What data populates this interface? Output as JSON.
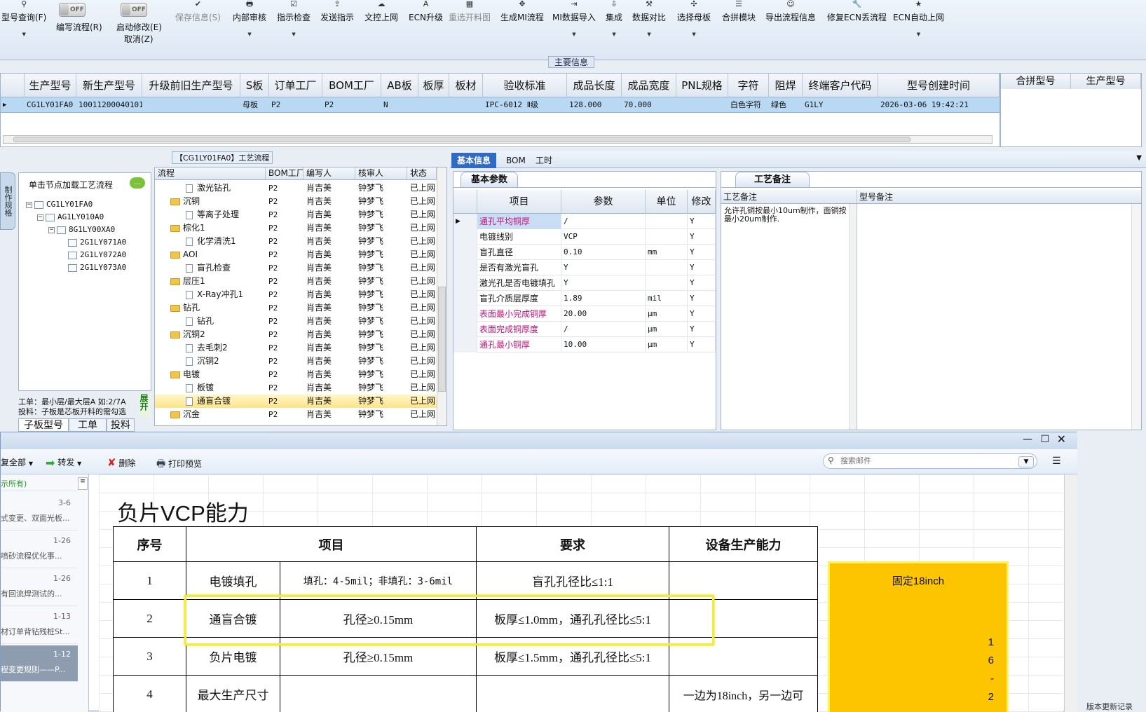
{
  "toolbar": {
    "items": [
      {
        "label": "型号查询(F)",
        "icon": "⚲"
      },
      {
        "label": "保存信息(S)",
        "icon": "✔"
      },
      {
        "label": "内部审核",
        "icon": "🖶"
      },
      {
        "label": "指示检查",
        "icon": "☑"
      },
      {
        "label": "发送指示",
        "icon": "⇪"
      },
      {
        "label": "文控上网",
        "icon": "☁"
      },
      {
        "label": "ECN升级",
        "icon": "A"
      },
      {
        "label": "重选开料图",
        "icon": "▦"
      },
      {
        "label": "生成MI流程",
        "icon": "✥"
      },
      {
        "label": "MI数据导入",
        "icon": "⇥"
      },
      {
        "label": "集成",
        "icon": "⇩"
      },
      {
        "label": "数据对比",
        "icon": "⚒"
      },
      {
        "label": "选择母板",
        "icon": "✣"
      },
      {
        "label": "合拼模块",
        "icon": "☰"
      },
      {
        "label": "导出流程信息",
        "icon": "☺"
      },
      {
        "label": "修复ECN丢流程",
        "icon": "🔧"
      },
      {
        "label": "ECN自动上网",
        "icon": "★"
      }
    ],
    "toggle_text": "OFF",
    "write_flow": "编写流程(R)",
    "start_edit": "启动修改(E)",
    "cancel": "取消(Z)"
  },
  "main_info": {
    "title": "主要信息",
    "columns": [
      "生产型号",
      "新生产型号",
      "升级前旧生产型号",
      "S板",
      "订单工厂",
      "BOM工厂",
      "AB板",
      "板厚",
      "板材",
      "验收标准",
      "成品长度",
      "成品宽度",
      "PNL规格",
      "字符",
      "阻焊",
      "终端客户代码",
      "型号创建时间"
    ],
    "row": [
      "CG1LY01FA0",
      "10011200040101",
      "",
      "母板",
      "P2",
      "P2",
      "N",
      "",
      "",
      "IPC-6012 Ⅱ级",
      "128.000",
      "70.000",
      "",
      "白色字符",
      "绿色",
      "G1LY",
      "2026-03-06 19:42:21"
    ],
    "right_columns": [
      "合拼型号",
      "生产型号"
    ]
  },
  "tree": {
    "vtab": "制作规格",
    "header": "单击节点加载工艺流程",
    "nodes": [
      "CG1LY01FA0",
      "AG1LY010A0",
      "8G1LY00XA0",
      "2G1LY071A0",
      "2G1LY072A0",
      "2G1LY073A0"
    ],
    "note1": "工单：最小层/最大层A 如:2/7A",
    "note2": "投料：子板是芯板开料的需勾选",
    "expand": "展开",
    "tabs": [
      "子板型号",
      "工单",
      "投料"
    ]
  },
  "process": {
    "title": "【CG1LY01FA0】工艺流程",
    "columns": [
      "流程",
      "BOM工厂",
      "编写人",
      "核审人",
      "状态"
    ],
    "rows": [
      {
        "name": "激光钻孔",
        "level": 2,
        "type": "doc",
        "bom": "P2",
        "writer": "肖吉美",
        "checker": "钟梦飞",
        "status": "已上网"
      },
      {
        "name": "沉铜",
        "level": 1,
        "type": "folder",
        "bom": "P2",
        "writer": "肖吉美",
        "checker": "钟梦飞",
        "status": "已上网"
      },
      {
        "name": "等离子处理",
        "level": 2,
        "type": "doc",
        "bom": "P2",
        "writer": "肖吉美",
        "checker": "钟梦飞",
        "status": "已上网"
      },
      {
        "name": "棕化1",
        "level": 1,
        "type": "folder",
        "bom": "P2",
        "writer": "肖吉美",
        "checker": "钟梦飞",
        "status": "已上网"
      },
      {
        "name": "化学清洗1",
        "level": 2,
        "type": "doc",
        "bom": "P2",
        "writer": "肖吉美",
        "checker": "钟梦飞",
        "status": "已上网"
      },
      {
        "name": "AOI",
        "level": 1,
        "type": "folder",
        "bom": "P2",
        "writer": "肖吉美",
        "checker": "钟梦飞",
        "status": "已上网"
      },
      {
        "name": "盲孔检查",
        "level": 2,
        "type": "doc",
        "bom": "P2",
        "writer": "肖吉美",
        "checker": "钟梦飞",
        "status": "已上网"
      },
      {
        "name": "层压1",
        "level": 1,
        "type": "folder",
        "bom": "P2",
        "writer": "肖吉美",
        "checker": "钟梦飞",
        "status": "已上网"
      },
      {
        "name": "X-Ray冲孔1",
        "level": 2,
        "type": "doc",
        "bom": "P2",
        "writer": "肖吉美",
        "checker": "钟梦飞",
        "status": "已上网"
      },
      {
        "name": "钻孔",
        "level": 1,
        "type": "folder",
        "bom": "P2",
        "writer": "肖吉美",
        "checker": "钟梦飞",
        "status": "已上网"
      },
      {
        "name": "钻孔",
        "level": 2,
        "type": "doc",
        "bom": "P2",
        "writer": "肖吉美",
        "checker": "钟梦飞",
        "status": "已上网"
      },
      {
        "name": "沉铜2",
        "level": 1,
        "type": "folder",
        "bom": "P2",
        "writer": "肖吉美",
        "checker": "钟梦飞",
        "status": "已上网"
      },
      {
        "name": "去毛刺2",
        "level": 2,
        "type": "doc",
        "bom": "P2",
        "writer": "肖吉美",
        "checker": "钟梦飞",
        "status": "已上网"
      },
      {
        "name": "沉铜2",
        "level": 2,
        "type": "doc",
        "bom": "P2",
        "writer": "肖吉美",
        "checker": "钟梦飞",
        "status": "已上网"
      },
      {
        "name": "电镀",
        "level": 1,
        "type": "folder",
        "bom": "P2",
        "writer": "肖吉美",
        "checker": "钟梦飞",
        "status": "已上网"
      },
      {
        "name": "板镀",
        "level": 2,
        "type": "doc",
        "bom": "P2",
        "writer": "肖吉美",
        "checker": "钟梦飞",
        "status": "已上网"
      },
      {
        "name": "通盲合镀",
        "level": 2,
        "type": "doc",
        "bom": "P2",
        "writer": "肖吉美",
        "checker": "钟梦飞",
        "status": "已上网",
        "selected": true
      },
      {
        "name": "沉金",
        "level": 1,
        "type": "folder",
        "bom": "P2",
        "writer": "肖吉美",
        "checker": "钟梦飞",
        "status": "已上网"
      }
    ]
  },
  "right_tabs": [
    "基本信息",
    "BOM",
    "工时"
  ],
  "params": {
    "tab": "基本参数",
    "columns": [
      "项目",
      "参数",
      "单位",
      "修改"
    ],
    "rows": [
      {
        "item": "通孔平均铜厚",
        "value": "/",
        "unit": "",
        "mod": "Y",
        "pink": true
      },
      {
        "item": "电镀线别",
        "value": "VCP",
        "unit": "",
        "mod": "Y",
        "pink": false
      },
      {
        "item": "盲孔直径",
        "value": "0.10",
        "unit": "mm",
        "mod": "Y",
        "pink": false
      },
      {
        "item": "是否有激光盲孔",
        "value": "Y",
        "unit": "",
        "mod": "Y",
        "pink": false
      },
      {
        "item": "激光孔是否电镀填孔",
        "value": "Y",
        "unit": "",
        "mod": "Y",
        "pink": false
      },
      {
        "item": "盲孔介质层厚度",
        "value": "1.89",
        "unit": "mil",
        "mod": "Y",
        "pink": false
      },
      {
        "item": "表面最小完成铜厚",
        "value": "20.00",
        "unit": "μm",
        "mod": "Y",
        "pink": true
      },
      {
        "item": "表面完成铜厚度",
        "value": "/",
        "unit": "μm",
        "mod": "Y",
        "pink": true
      },
      {
        "item": "通孔最小铜厚",
        "value": "10.00",
        "unit": "μm",
        "mod": "Y",
        "pink": true
      }
    ]
  },
  "notes": {
    "tab": "工艺备注",
    "col1": "工艺备注",
    "col2": "型号备注",
    "text": "允许孔铜按最小10um制作，面铜按最小20um制作."
  },
  "mail": {
    "toolbar": {
      "reply_all": "复全部",
      "forward": "转发",
      "delete": "删除",
      "print_preview": "打印预览"
    },
    "search_placeholder": "搜索邮件",
    "list_header": "示所有)",
    "items": [
      {
        "date": "3-6",
        "subject": "式变更、双面光板..."
      },
      {
        "date": "1-26",
        "subject": "喷砂流程优化事..."
      },
      {
        "date": "1-26",
        "subject": "有回流焊测试的..."
      },
      {
        "date": "1-13",
        "subject": "材订单背钻残桩St..."
      },
      {
        "date": "1-12",
        "subject": "程变更规则——P...",
        "selected": true
      }
    ],
    "doc_title": "负片VCP能力",
    "table_headers": [
      "序号",
      "项目",
      "要求",
      "设备生产能力"
    ],
    "table_rows": [
      [
        "1",
        "电镀填孔",
        "填孔：4-5mil；非填孔：3-6mil",
        "盲孔孔径比≤1:1",
        ""
      ],
      [
        "2",
        "通盲合镀",
        "孔径≥0.15mm",
        "板厚≤1.0mm，通孔孔径比≤5:1",
        ""
      ],
      [
        "3",
        "负片电镀",
        "孔径≥0.15mm",
        "板厚≤1.5mm，通孔孔径比≤5:1",
        ""
      ],
      [
        "4",
        "最大生产尺寸",
        "",
        "",
        "一边为18inch，另一边可"
      ]
    ],
    "fixed_note": "固定18inch",
    "vertical_chars": [
      "1",
      "6",
      "-",
      "2"
    ],
    "status_right": "版本更新记录"
  }
}
